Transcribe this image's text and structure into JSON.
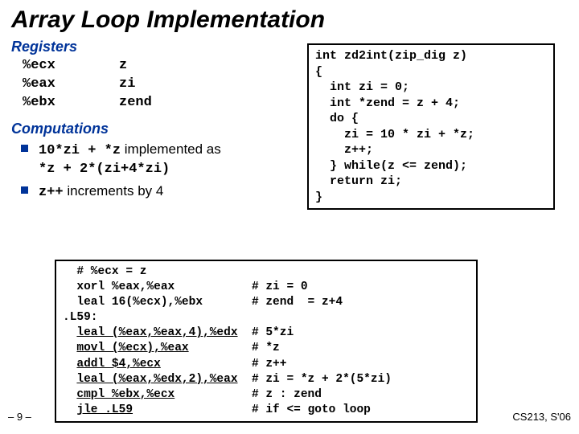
{
  "title": "Array Loop Implementation",
  "registers": {
    "header": "Registers",
    "rows": [
      {
        "reg": "%ecx",
        "var": "z"
      },
      {
        "reg": "%eax",
        "var": "zi"
      },
      {
        "reg": "%ebx",
        "var": "zend"
      }
    ]
  },
  "computations": {
    "header": "Computations",
    "items": [
      {
        "pre1": "10*zi + *z",
        "mid": " implemented as ",
        "pre2": "*z + 2*(zi+4*zi)"
      },
      {
        "pre1": "z++",
        "mid": " increments by 4"
      }
    ]
  },
  "c_code": "int zd2int(zip_dig z)\n{\n  int zi = 0;\n  int *zend = z + 4;\n  do {\n    zi = 10 * zi + *z;\n    z++;\n  } while(z <= zend);\n  return zi;\n}",
  "asm": {
    "lines": [
      {
        "code": "  # %ecx = z",
        "comment": ""
      },
      {
        "code": "  xorl %eax,%eax",
        "comment": "# zi = 0",
        "u": false
      },
      {
        "code": "  leal 16(%ecx),%ebx",
        "comment": "# zend  = z+4",
        "u": false
      },
      {
        "code": ".L59:",
        "comment": ""
      },
      {
        "code": "  leal (%eax,%eax,4),%edx",
        "comment": "# 5*zi",
        "u": true
      },
      {
        "code": "  movl (%ecx),%eax",
        "comment": "# *z",
        "u": true
      },
      {
        "code": "  addl $4,%ecx",
        "comment": "# z++",
        "u": true
      },
      {
        "code": "  leal (%eax,%edx,2),%eax",
        "comment": "# zi = *z + 2*(5*zi)",
        "u": true
      },
      {
        "code": "  cmpl %ebx,%ecx",
        "comment": "# z : zend",
        "u": true
      },
      {
        "code": "  jle .L59",
        "comment": "# if <= goto loop",
        "u": true
      }
    ]
  },
  "pagenum": "– 9 –",
  "course": "CS213, S'06"
}
